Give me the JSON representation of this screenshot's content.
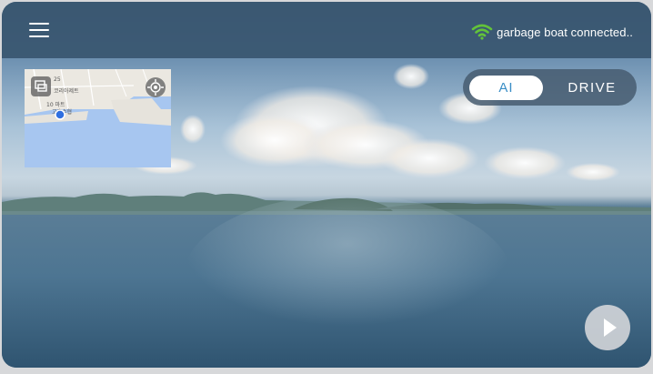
{
  "status_bar": {
    "connection_text": "garbage boat connected..",
    "wifi_color": "#63c33a"
  },
  "mode_toggle": {
    "options": [
      "AI",
      "DRIVE"
    ],
    "selected": "AI",
    "accent_color": "#3a8ec6"
  },
  "minimap": {
    "labels": [
      "10 마트",
      "코리아제트",
      "고흥수협",
      "25"
    ],
    "icons": [
      "layers-icon",
      "locate-icon",
      "location-pin-icon"
    ]
  },
  "controls": {
    "menu_icon": "hamburger-menu-icon",
    "play_icon": "play-icon"
  }
}
